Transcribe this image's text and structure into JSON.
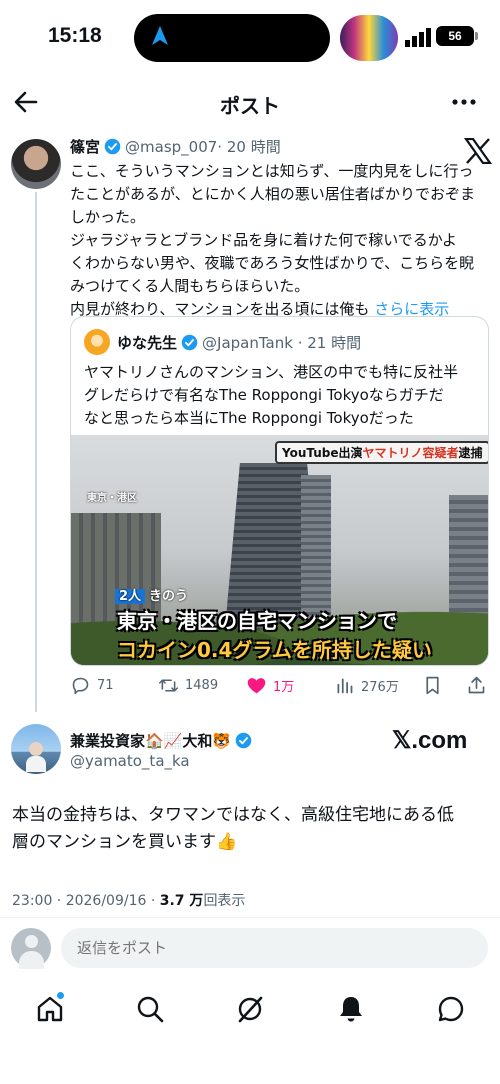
{
  "status_bar": {
    "time": "15:18",
    "battery": "56"
  },
  "header": {
    "title": "ポスト"
  },
  "post": {
    "author_name": "篠宮",
    "author_handle": "@masp_007",
    "time": "· 20 時間",
    "text_lines": [
      "ここ、そういうマンションとは知らず、一度内見をしに行っ",
      "たことがあるが、とにかく人相の悪い居住者ばかりでおぞま",
      "しかった。",
      "ジャラジャラとブランド品を身に着けた何で稼いでるかよ",
      "くわからない男や、夜職であろう女性ばかりで、こちらを睨",
      "みつけてくる人間もちらほらいた。",
      "内見が終わり、マンションを出る頃には俺も"
    ],
    "show_more": "さらに表示"
  },
  "quote": {
    "author_name": "ゆな先生",
    "author_handle": "@JapanTank",
    "time": "· 21 時間",
    "text_lines": [
      "ヤマトリノさんのマンション、港区の中でも特に反社半",
      "グレだらけで有名なThe Roppongi Tokyoならガチだ",
      "なと思ったら本当にThe Roppongi Tokyoだった"
    ],
    "image": {
      "banner_prefix": "YouTube出演",
      "banner_highlight": "ヤマトリノ容疑者",
      "banner_suffix": "逮捕",
      "location": "東京・港区",
      "badge": "2人",
      "badge_suffix": "きのう",
      "caption1": "東京・港区の自宅マンションで",
      "caption2": "コカイン0.4グラムを所持した疑い"
    }
  },
  "actions": {
    "replies": "71",
    "reposts": "1489",
    "likes": "1万",
    "views": "276万"
  },
  "embedded": {
    "name": "兼業投資家🏠📈大和🐯",
    "handle": "@yamato_ta_ka",
    "watermark": "𝕏.com",
    "text_lines": [
      "本当の金持ちは、タワマンではなく、高級住宅地にある低",
      "層のマンションを買います👍"
    ],
    "datetime": "23:00 · 2026/09/16 · ",
    "views": "3.7 万",
    "views_suffix": "回表示"
  },
  "reply": {
    "placeholder": "返信をポスト"
  },
  "colors": {
    "accent": "#1d9bf0",
    "like": "#f91880",
    "secondary_text": "#536471"
  }
}
